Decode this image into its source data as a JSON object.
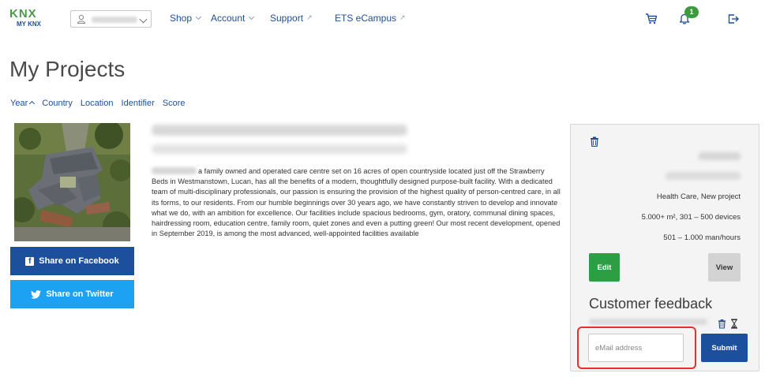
{
  "nav": {
    "logo_mark": "KNX",
    "logo_sub": "MY KNX",
    "shop": "Shop",
    "account": "Account",
    "support": "Support",
    "campus": "ETS eCampus",
    "notification_count": "1",
    "icons": [
      "user-icon",
      "cart-icon",
      "bell-icon",
      "logout-icon",
      "external-link-icon"
    ]
  },
  "page": {
    "title": "My Projects"
  },
  "sort": {
    "items": [
      "Year",
      "Country",
      "Location",
      "Identifier",
      "Score"
    ],
    "active": "Year",
    "direction": "ascending"
  },
  "share": {
    "facebook": "Share on Facebook",
    "twitter": "Share on Twitter"
  },
  "project": {
    "description": "a family owned and operated care centre set on 16 acres of open countryside located just off the Strawberry Beds in Westmanstown, Lucan, has all the benefits of a modern, thoughtfully designed purpose-built facility. With a dedicated team of multi-disciplinary professionals, our passion is ensuring the provision of the highest quality of person-centred care, in all its forms, to our residents. From our humble beginnings over 30 years ago, we have constantly striven to develop and innovate what we do, with an ambition for excellence. Our facilities include spacious bedrooms, gym, oratory, communal dining spaces, hairdressing room, education centre, family room, quiet zones and even a putting green! Our most recent development, opened in September 2019, is among the most advanced, well-appointed facilities available",
    "category": "Health Care, New project",
    "size": "5.000+ m², 301 – 500 devices",
    "hours": "501 – 1.000 man/hours",
    "edit_label": "Edit",
    "view_label": "View"
  },
  "feedback": {
    "title": "Customer feedback",
    "email_placeholder": "eMail address",
    "submit_label": "Submit"
  },
  "colors": {
    "brand_blue": "#1c4f9c",
    "link_blue": "#1f4f96",
    "edit_green": "#2e9e44",
    "twitter_blue": "#1da1f2",
    "highlight_red": "#e53030"
  }
}
